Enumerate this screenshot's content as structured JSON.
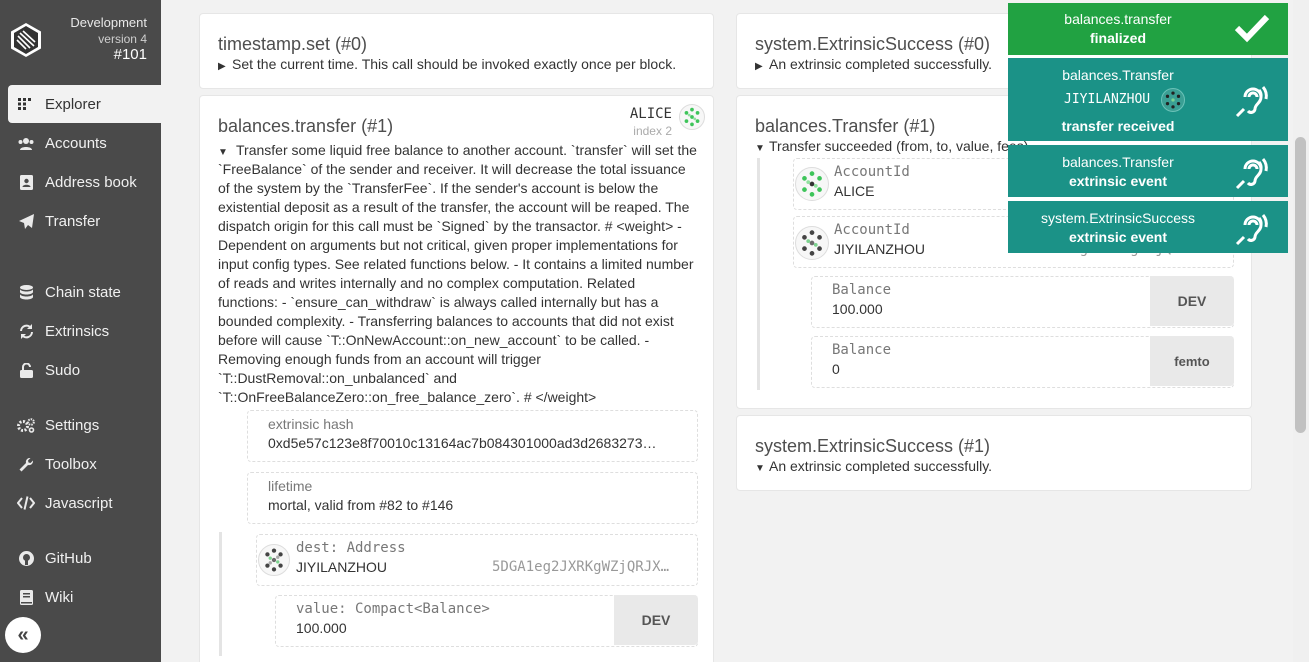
{
  "brand": {
    "chain": "Development",
    "version": "version 4",
    "block": "#101"
  },
  "nav": {
    "explorer": "Explorer",
    "accounts": "Accounts",
    "address_book": "Address book",
    "transfer": "Transfer",
    "chain_state": "Chain state",
    "extrinsics": "Extrinsics",
    "sudo": "Sudo",
    "settings": "Settings",
    "toolbox": "Toolbox",
    "javascript": "Javascript",
    "github": "GitHub",
    "wiki": "Wiki",
    "collapse": "«"
  },
  "extrinsics": {
    "timestamp": {
      "title": "timestamp.set (#0)",
      "summary": "Set the current time. This call should be invoked exactly once per block."
    },
    "transfer": {
      "title": "balances.transfer (#1)",
      "signer": "ALICE",
      "signer_index": "index 2",
      "description": "Transfer some liquid free balance to another account. `transfer` will set the `FreeBalance` of the sender and receiver. It will decrease the total issuance of the system by the `TransferFee`. If the sender's account is below the existential deposit as a result of the transfer, the account will be reaped. The dispatch origin for this call must be `Signed` by the transactor. # <weight> - Dependent on arguments but not critical, given proper implementations for input config types. See related functions below. - It contains a limited number of reads and writes internally and no complex computation. Related functions: - `ensure_can_withdraw` is always called internally but has a bounded complexity. - Transferring balances to accounts that did not exist before will cause `T::OnNewAccount::on_new_account` to be called. - Removing enough funds from an account will trigger `T::DustRemoval::on_unbalanced` and `T::OnFreeBalanceZero::on_free_balance_zero`. # </weight>",
      "hash_label": "extrinsic hash",
      "hash_value": "0xd5e57c123e8f70010c13164ac7b084301000ad3d2683273…",
      "lifetime_label": "lifetime",
      "lifetime_value": "mortal, valid from #82 to #146",
      "dest_label": "dest: Address",
      "dest_name": "JIYILANZHOU",
      "dest_address": "5DGA1eg2JXRKgWZjQRJX…",
      "value_label": "value: Compact<Balance>",
      "value_amount": "100.000",
      "value_unit": "DEV"
    }
  },
  "events": {
    "ext_success0": {
      "title": "system.ExtrinsicSuccess (#0)",
      "summary": "An extrinsic completed successfully."
    },
    "transfer": {
      "title": "balances.Transfer (#1)",
      "summary": "Transfer succeeded (from, to, value, fees).",
      "from_label": "AccountId",
      "from_value": "ALICE",
      "to_label": "AccountId",
      "to_value": "JIYILANZHOU",
      "to_address": "5DGA1eg2JXRKgWZjQRJX…",
      "balance1_label": "Balance",
      "balance1_value": "100.000",
      "balance1_unit": "DEV",
      "balance2_label": "Balance",
      "balance2_value": "0",
      "balance2_unit": "femto"
    },
    "ext_success1": {
      "title": "system.ExtrinsicSuccess (#1)",
      "summary": "An extrinsic completed successfully."
    }
  },
  "toasts": [
    {
      "title": "balances.transfer",
      "status": "finalized",
      "color": "#21a242",
      "icon": "check-icon"
    },
    {
      "title": "balances.Transfer",
      "account": "JIYILANZHOU",
      "status": "transfer received",
      "color": "#1b9287",
      "icon": "hearing-icon"
    },
    {
      "title": "balances.Transfer",
      "status": "extrinsic event",
      "color": "#1b9287",
      "icon": "hearing-icon"
    },
    {
      "title": "system.ExtrinsicSuccess",
      "status": "extrinsic event",
      "color": "#1b9287",
      "icon": "hearing-icon"
    }
  ]
}
